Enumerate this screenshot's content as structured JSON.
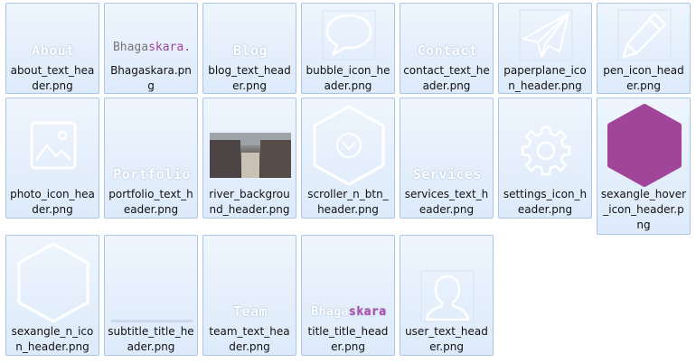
{
  "files": [
    {
      "name": "about_text_header.png",
      "thumb": {
        "kind": "text",
        "text": "About"
      }
    },
    {
      "name": "Bhagaskara.png",
      "thumb": {
        "kind": "logo",
        "part1": "Bhaga",
        "part2": "skara."
      }
    },
    {
      "name": "blog_text_header.png",
      "thumb": {
        "kind": "text",
        "text": "Blog"
      }
    },
    {
      "name": "bubble_icon_header.png",
      "thumb": {
        "kind": "icon",
        "icon": "speech-bubble-icon"
      }
    },
    {
      "name": "contact_text_header.png",
      "thumb": {
        "kind": "text",
        "text": "Contact"
      }
    },
    {
      "name": "paperplane_icon_header.png",
      "thumb": {
        "kind": "icon",
        "icon": "paper-plane-icon"
      }
    },
    {
      "name": "pen_icon_header.png",
      "thumb": {
        "kind": "icon",
        "icon": "pencil-icon"
      }
    },
    {
      "name": "photo_icon_header.png",
      "thumb": {
        "kind": "icon",
        "icon": "photo-icon"
      }
    },
    {
      "name": "portfolio_text_header.png",
      "thumb": {
        "kind": "text",
        "text": "Portfolio"
      }
    },
    {
      "name": "river_background_header.png",
      "thumb": {
        "kind": "photo",
        "icon": "river-photo"
      }
    },
    {
      "name": "scroller_n_btn_header.png",
      "thumb": {
        "kind": "icon",
        "icon": "hexagon-chevron-icon"
      }
    },
    {
      "name": "services_text_header.png",
      "thumb": {
        "kind": "text",
        "text": "Services"
      }
    },
    {
      "name": "settings_icon_header.png",
      "thumb": {
        "kind": "icon",
        "icon": "gear-icon"
      }
    },
    {
      "name": "sexangle_hover_icon_header.png",
      "thumb": {
        "kind": "icon",
        "icon": "filled-hexagon-icon"
      }
    },
    {
      "name": "sexangle_n_icon_header.png",
      "thumb": {
        "kind": "icon",
        "icon": "hexagon-outline-icon"
      }
    },
    {
      "name": "subtitle_title_header.png",
      "thumb": {
        "kind": "line",
        "icon": "subtitle-line"
      }
    },
    {
      "name": "team_text_header.png",
      "thumb": {
        "kind": "text",
        "text": "Team"
      }
    },
    {
      "name": "title_title_header.png",
      "thumb": {
        "kind": "logo-white",
        "part1": "Bhaga",
        "part2": "skara"
      }
    },
    {
      "name": "user_text_header.png",
      "thumb": {
        "kind": "icon",
        "icon": "user-silhouette-icon"
      }
    }
  ],
  "colors": {
    "hover_hexagon": "#a0459a",
    "tile_border": "#a9c6e8",
    "tile_bg": "#e4eefb"
  }
}
